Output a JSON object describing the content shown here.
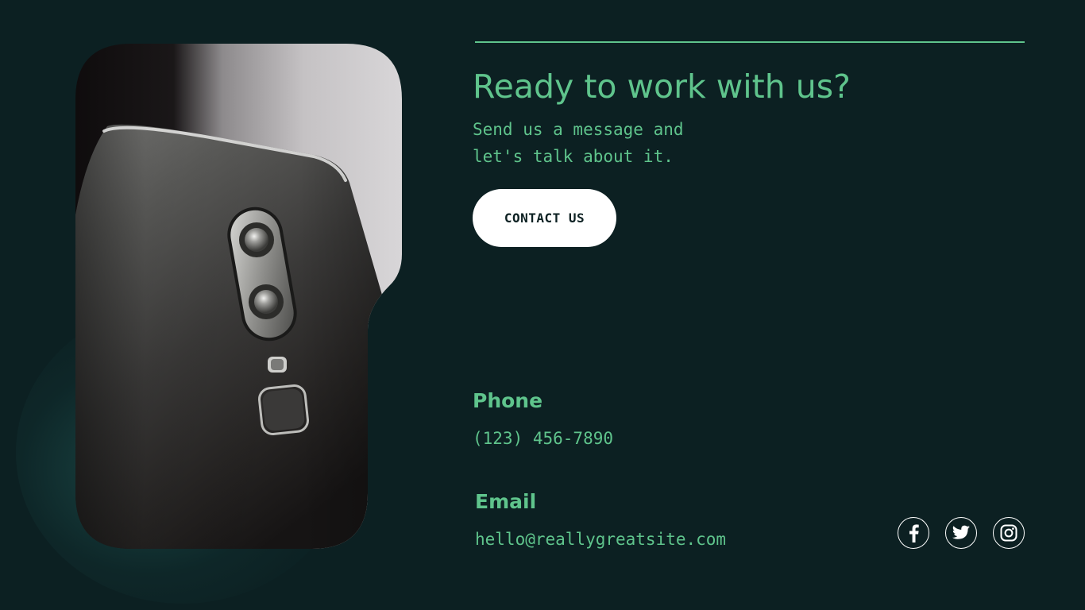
{
  "hero": {
    "headline": "Ready to work with us?",
    "subtext_line1": "Send us a message and",
    "subtext_line2": "let's talk about it.",
    "cta_label": "CONTACT US"
  },
  "contact": {
    "phone_label": "Phone",
    "phone_value": "(123) 456-7890",
    "email_label": "Email",
    "email_value": "hello@reallygreatsite.com"
  },
  "social": [
    {
      "icon": "facebook-icon"
    },
    {
      "icon": "twitter-icon"
    },
    {
      "icon": "instagram-icon"
    }
  ],
  "colors": {
    "background": "#0c2022",
    "accent": "#5fc48c",
    "button_bg": "#ffffff",
    "button_text": "#0c2022"
  }
}
